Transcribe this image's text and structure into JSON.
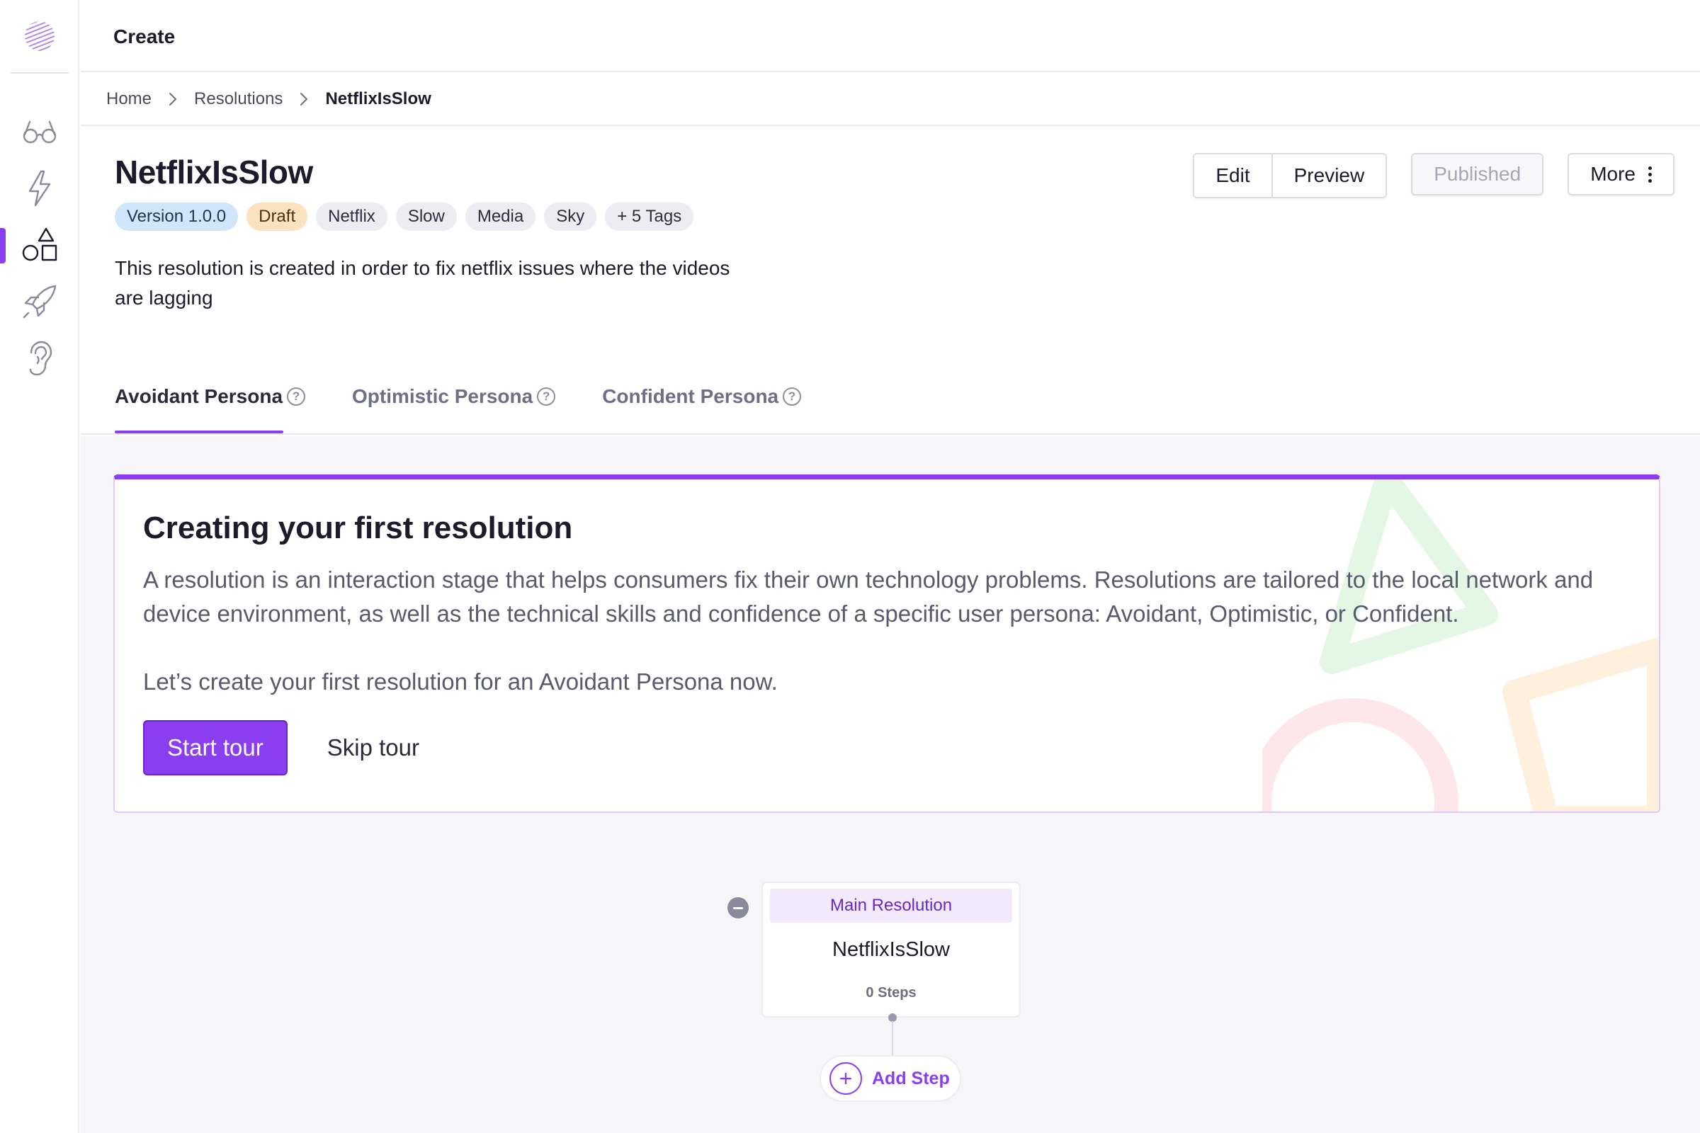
{
  "topbar": {
    "title": "Create"
  },
  "breadcrumb": {
    "home": "Home",
    "section": "Resolutions",
    "current": "NetflixIsSlow"
  },
  "resolution": {
    "title": "NetflixIsSlow",
    "tags": {
      "version": "Version 1.0.0",
      "status": "Draft",
      "t1": "Netflix",
      "t2": "Slow",
      "t3": "Media",
      "t4": "Sky",
      "more": "+ 5 Tags"
    },
    "description": "This resolution is created in order to fix netflix issues where the videos are lagging"
  },
  "actions": {
    "edit": "Edit",
    "preview": "Preview",
    "published": "Published",
    "more": "More"
  },
  "tabs": {
    "avoidant": "Avoidant Persona",
    "optimistic": "Optimistic Persona",
    "confident": "Confident Persona",
    "help_glyph": "?"
  },
  "tour": {
    "title": "Creating your first resolution",
    "body": "A resolution is an interaction stage that helps consumers fix their own technology problems.  Resolutions are tailored to the local network and device environment, as well as the technical skills and confidence of a specific user persona: Avoidant, Optimistic, or Confident.",
    "cta_text": "Let’s create your first resolution for an Avoidant Persona now.",
    "start": "Start tour",
    "skip": "Skip tour"
  },
  "flow": {
    "node": {
      "header": "Main Resolution",
      "name": "NetflixIsSlow",
      "steps": "0 Steps"
    },
    "add_step": "Add Step"
  },
  "colors": {
    "accent": "#8b3df0",
    "version_tag": "#cfe6fb",
    "draft_tag": "#fde2c0",
    "background": "#f6f6f9"
  },
  "icons": [
    "logo-icon",
    "glasses-icon",
    "lightning-icon",
    "shapes-icon",
    "rocket-icon",
    "ear-icon",
    "chevron-right-icon",
    "kebab-icon",
    "help-icon",
    "plus-icon",
    "collapse-icon"
  ]
}
